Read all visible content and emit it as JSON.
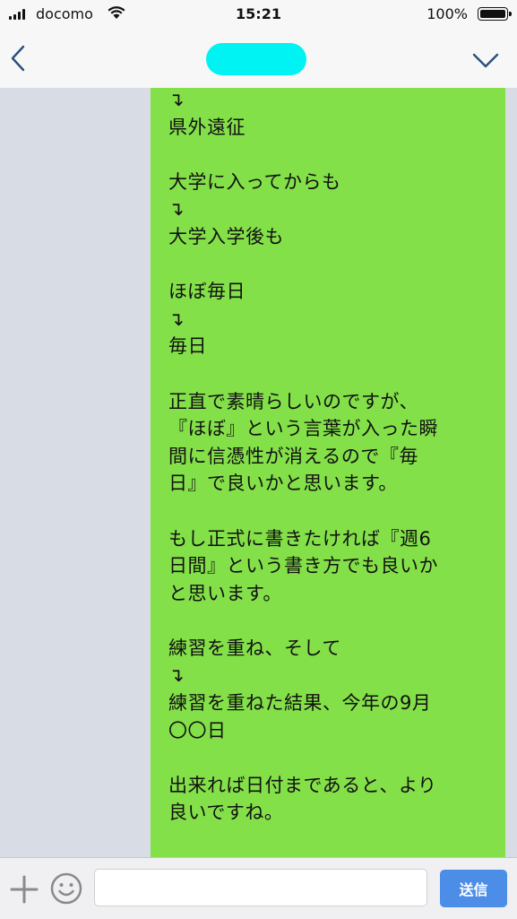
{
  "status_bar": {
    "carrier": "docomo",
    "time": "15:21",
    "battery": "100%",
    "battery_level": 1.0
  },
  "nav": {
    "back_icon": "chevron-left-icon",
    "menu_icon": "chevron-down-icon"
  },
  "chat": {
    "bubble_color": "#84e049",
    "background_color": "#d7dce5",
    "message_text": "↴\n県外遠征\n\n大学に入ってからも\n↴\n大学入学後も\n\nほぼ毎日\n↴\n毎日\n\n正直で素晴らしいのですが、\n『ほぼ』という言葉が入った瞬\n間に信憑性が消えるので『毎\n日』で良いかと思います。\n\nもし正式に書きたければ『週6\n日間』という書き方でも良いか\nと思います。\n\n練習を重ね、そして\n↴\n練習を重ねた結果、今年の9月\n〇〇日\n\n出来れば日付まであると、より\n良いですね。\n\n小さい頃から目標を"
  },
  "input_bar": {
    "plus_icon": "plus-icon",
    "emoji_icon": "smiley-icon",
    "message_value": "",
    "send_label": "送信",
    "send_color": "#4c8de8"
  }
}
